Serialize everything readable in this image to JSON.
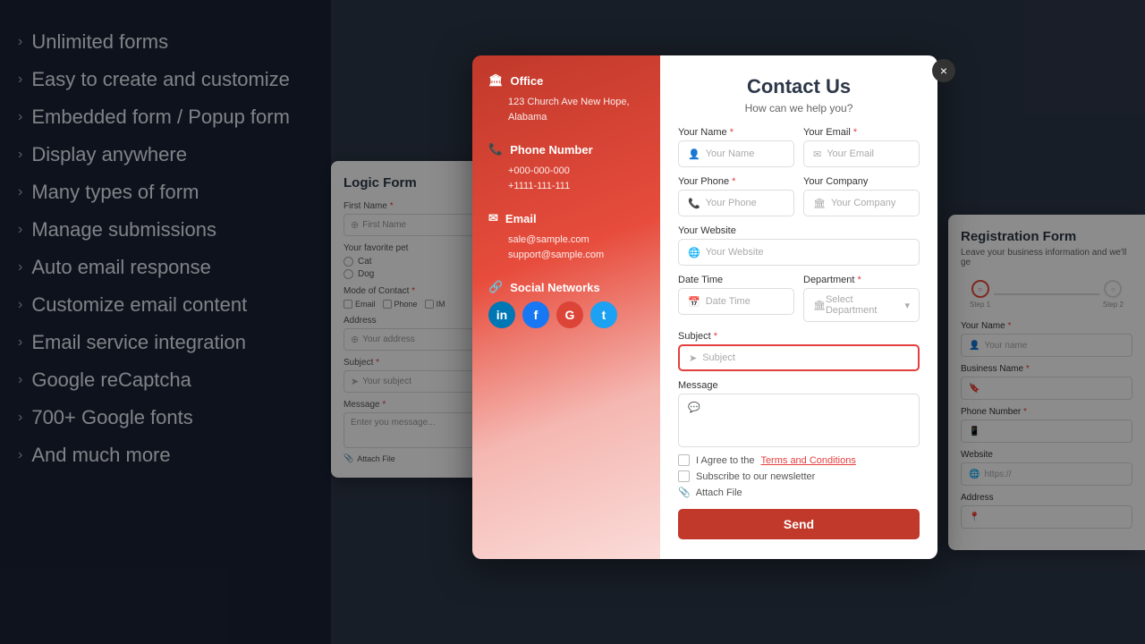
{
  "leftPanel": {
    "features": [
      "Unlimited forms",
      "Easy to create and customize",
      "Embedded form / Popup form",
      "Display anywhere",
      "Many types of form",
      "Manage submissions",
      "Auto email response",
      "Customize email content",
      "Email service integration",
      "Google reCaptcha",
      "700+ Google fonts",
      "And much more"
    ]
  },
  "logicForm": {
    "title": "Logic Form",
    "firstNameLabel": "First Name",
    "required": "*",
    "firstNamePlaceholder": "First Name",
    "favoritePetLabel": "Your favorite pet",
    "pets": [
      "Cat",
      "Dog"
    ],
    "modeLabel": "Mode of Contact",
    "modeRequired": "*",
    "modes": [
      "Email",
      "Phone",
      "IM"
    ],
    "addressLabel": "Address",
    "addressPlaceholder": "Your address",
    "subjectLabel": "Subject",
    "subjectRequired": "*",
    "subjectPlaceholder": "Your subject",
    "messageLabel": "Message",
    "messageRequired": "*",
    "messagePlaceholder": "Enter you message...",
    "attachLabel": "Attach File"
  },
  "contactModal": {
    "officeIcon": "🏛",
    "officeTitle": "Office",
    "officeAddress": "123 Church Ave New Hope, Alabama",
    "phoneIcon": "📞",
    "phoneTitle": "Phone Number",
    "phoneNumbers": [
      "+000-000-000",
      "+1111-111-111"
    ],
    "emailIcon": "✉",
    "emailTitle": "Email",
    "emails": [
      "sale@sample.com",
      "support@sample.com"
    ],
    "socialIcon": "🔗",
    "socialTitle": "Social Networks",
    "socials": [
      "li",
      "fb",
      "go",
      "tw"
    ],
    "formTitle": "Contact Us",
    "formSubtitle": "How can we help you?",
    "yourNameLabel": "Your Name",
    "yourEmailLabel": "Your Email",
    "yourPhoneLabel": "Your Phone",
    "yourCompanyLabel": "Your Company",
    "yourWebsiteLabel": "Your Website",
    "dateTimeLabel": "Date Time",
    "departmentLabel": "Department",
    "departmentPlaceholder": "Select Department",
    "subjectLabel": "Subject",
    "messageLabel": "Message",
    "termsText": "I Agree to the ",
    "termsLink": "Terms and Conditions",
    "newsletterText": "Subscribe to our newsletter",
    "attachText": "Attach File",
    "sendLabel": "Send",
    "placeholders": {
      "yourName": "Your Name",
      "yourEmail": "Your Email",
      "yourPhone": "Your Phone",
      "yourCompany": "Your Company",
      "yourWebsite": "Your Website",
      "dateTime": "Date Time",
      "subject": "Subject"
    }
  },
  "registrationForm": {
    "title": "Registration Form",
    "subtitle": "Leave your business information and we'll ge",
    "step1Label": "Step 1",
    "step2Label": "Step 2",
    "yourNameLabel": "Your Name",
    "yourNameRequired": "*",
    "yourNamePlaceholder": "Your name",
    "businessNameLabel": "Business Name",
    "businessNameRequired": "*",
    "businessNamePlaceholder": "",
    "phoneNumberLabel": "Phone Number",
    "phoneNumberRequired": "*",
    "phoneNumberPlaceholder": "",
    "websiteLabel": "Website",
    "websitePlaceholder": "https://",
    "addressLabel": "Address",
    "addressPlaceholder": ""
  },
  "closeButton": "×"
}
